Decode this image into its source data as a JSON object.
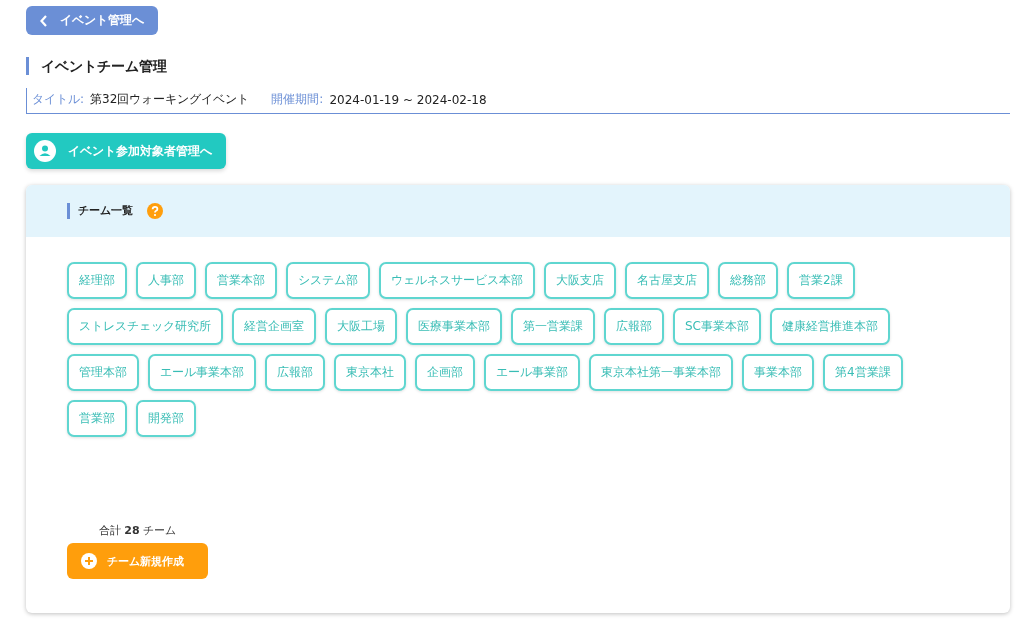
{
  "back_button": {
    "label": "イベント管理へ"
  },
  "page_title": "イベントチーム管理",
  "event_info": {
    "title_label": "タイトル:",
    "title_value": "第32回ウォーキングイベント",
    "period_label": "開催期間:",
    "period_value": "2024-01-19 ~ 2024-02-18"
  },
  "participants_button": {
    "label": "イベント参加対象者管理へ"
  },
  "team_panel": {
    "title": "チーム一覧",
    "teams": [
      "経理部",
      "人事部",
      "営業本部",
      "システム部",
      "ウェルネスサービス本部",
      "大阪支店",
      "名古屋支店",
      "総務部",
      "営業2課",
      "ストレスチェック研究所",
      "経営企画室",
      "大阪工場",
      "医療事業本部",
      "第一営業課",
      "広報部",
      "SC事業本部",
      "健康経営推進本部",
      "管理本部",
      "エール事業本部",
      "広報部",
      "東京本社",
      "企画部",
      "エール事業部",
      "東京本社第一事業本部",
      "事業本部",
      "第4営業課",
      "営業部",
      "開発部"
    ],
    "total": "合計 **28** チーム",
    "create_button": {
      "label": "チーム新規作成"
    }
  }
}
